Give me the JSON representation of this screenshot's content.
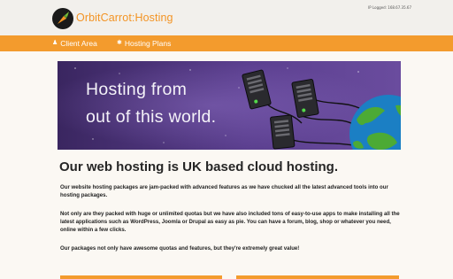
{
  "header": {
    "ip_label": "IP Logged: 168.67.35.67",
    "brand": "OrbitCarrot:Hosting",
    "brand_color": "#f39425"
  },
  "nav": {
    "items": [
      {
        "label": "Client Area",
        "icon": "user-icon"
      },
      {
        "label": "Hosting Plans",
        "icon": "star-icon"
      }
    ],
    "bar_color": "#f39b2d"
  },
  "banner": {
    "line1": "Hosting from",
    "line2": "out of this world."
  },
  "content": {
    "headline": "Our web hosting is UK based cloud hosting.",
    "paragraphs": [
      "Our website hosting packages are jam-packed with advanced features as we have chucked all the latest advanced tools into our hosting packages.",
      "Not only are they packed with huge or unlimited quotas but we have also included tons of easy-to-use apps to make installing all the latest applications such as WordPress, Joomla or Drupal as easy as pie. You can have a forum, blog, shop or whatever you need, online within a few clicks.",
      "Our packages not only have awesome quotas and features, but they're extremely great value!"
    ]
  }
}
